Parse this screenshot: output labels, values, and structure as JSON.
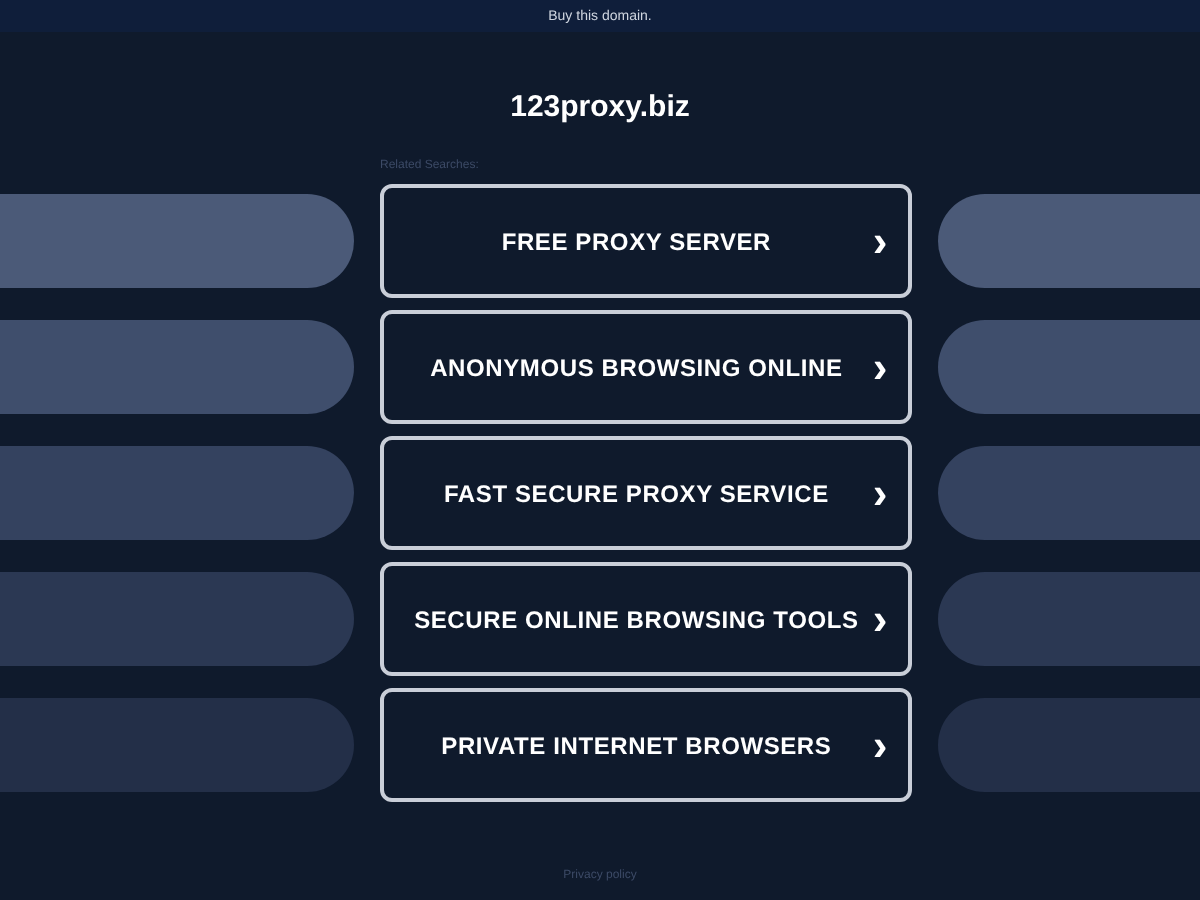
{
  "top_bar": {
    "link": "Buy this domain."
  },
  "domain": "123proxy.biz",
  "related_label": "Related Searches:",
  "searches": [
    {
      "label": "FREE PROXY SERVER",
      "icon": "›"
    },
    {
      "label": "ANONYMOUS BROWSING ONLINE",
      "icon": "›"
    },
    {
      "label": "FAST SECURE PROXY SERVICE",
      "icon": "›"
    },
    {
      "label": "SECURE ONLINE BROWSING TOOLS",
      "icon": "›"
    },
    {
      "label": "PRIVATE INTERNET BROWSERS",
      "icon": "›"
    }
  ],
  "footer": {
    "link": "Privacy policy"
  }
}
